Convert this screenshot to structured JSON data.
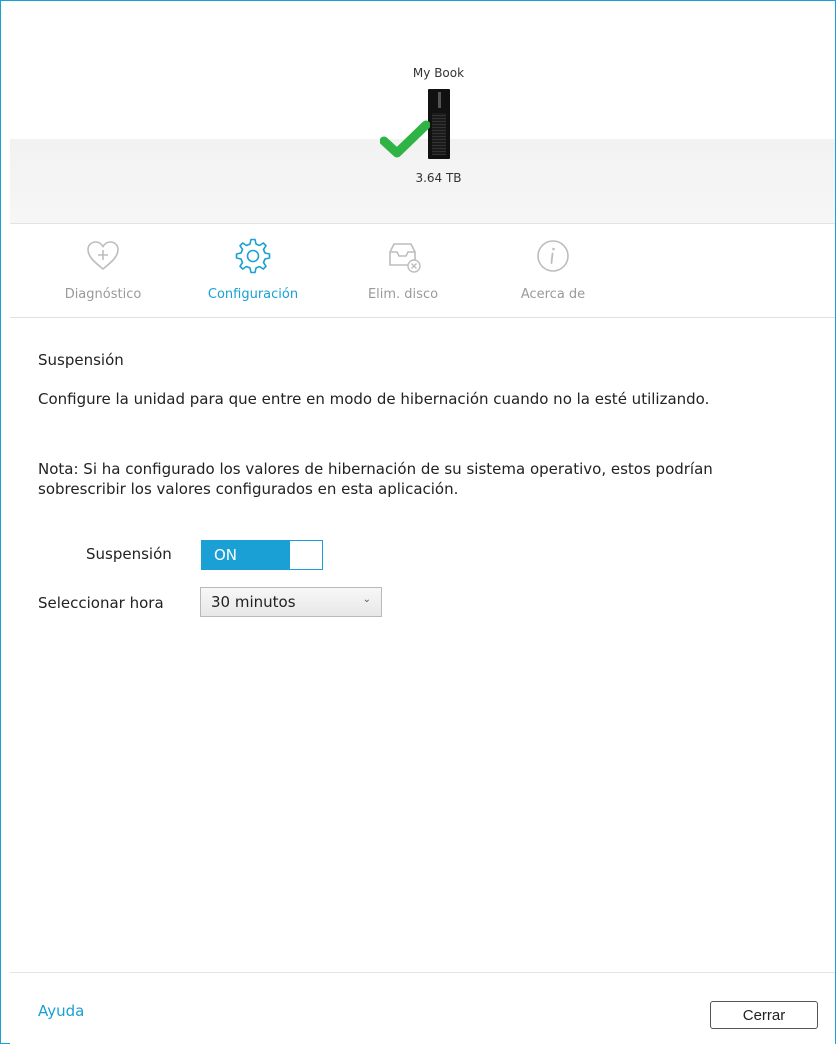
{
  "device": {
    "name": "My Book",
    "capacity": "3.64 TB",
    "status_color": "#2fb344"
  },
  "tabs": [
    {
      "label": "Diagnóstico",
      "icon": "heart-plus-icon",
      "active": false
    },
    {
      "label": "Configuración",
      "icon": "gear-icon",
      "active": true
    },
    {
      "label": "Elim. disco",
      "icon": "tray-erase-icon",
      "active": false
    },
    {
      "label": "Acerca de",
      "icon": "info-icon",
      "active": false
    }
  ],
  "settings": {
    "title": "Suspensión",
    "description": "Configure la unidad para que entre en modo de hibernación cuando no la esté utilizando.",
    "note": "Nota: Si ha configurado los valores de hibernación de su sistema operativo, estos podrían sobrescribir los valores configurados en esta aplicación.",
    "sleep_label": "Suspensión",
    "sleep_state": "ON",
    "time_label": "Seleccionar hora",
    "time_value": "30 minutos"
  },
  "footer": {
    "help_label": "Ayuda",
    "close_label": "Cerrar"
  },
  "colors": {
    "accent": "#1aa0d4",
    "inactive": "#9a9a9a"
  }
}
